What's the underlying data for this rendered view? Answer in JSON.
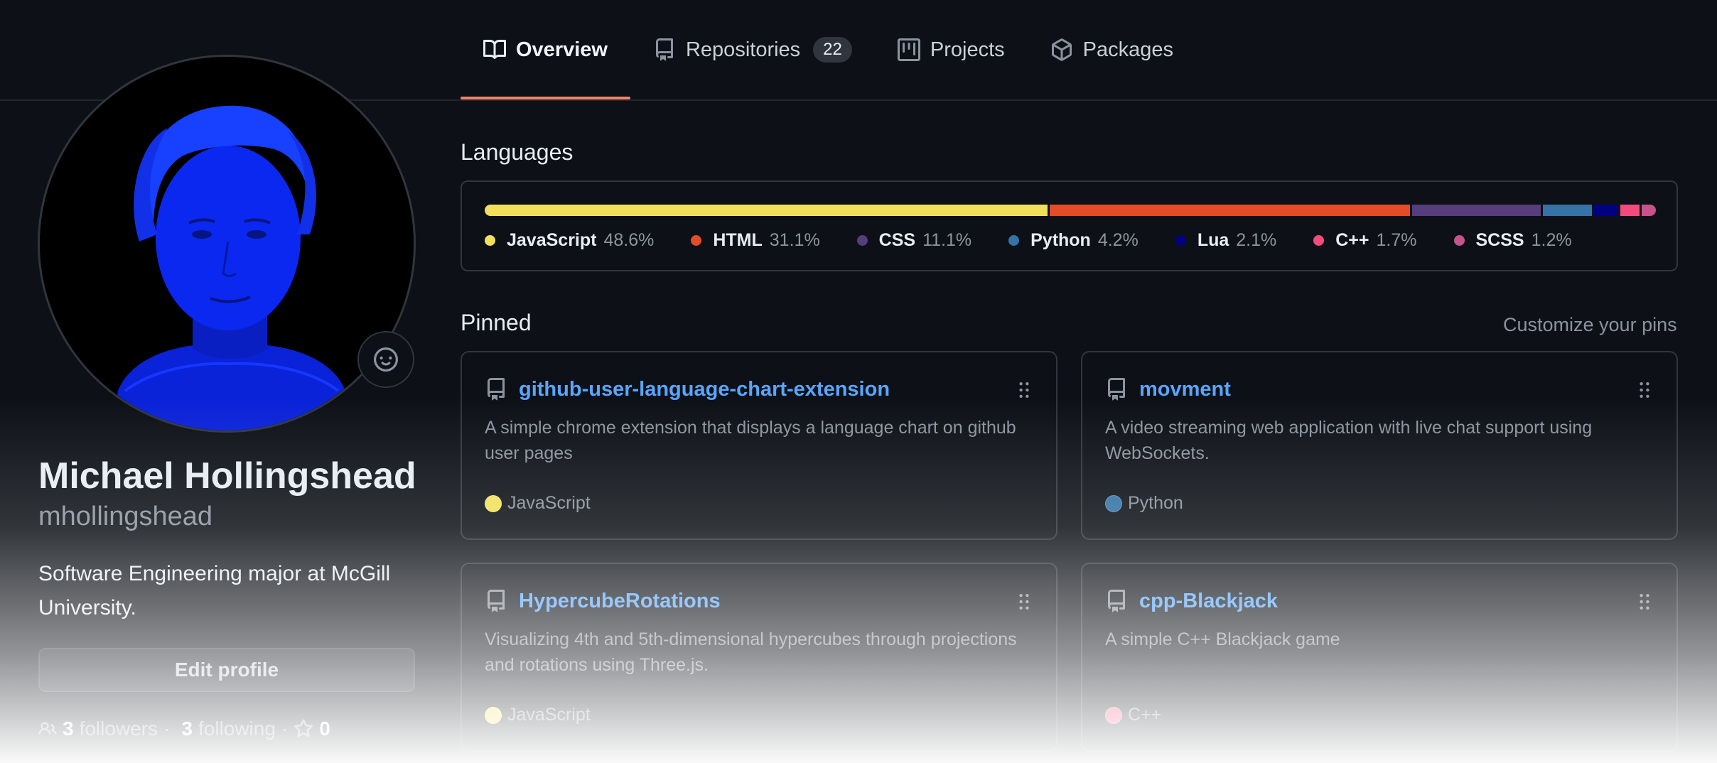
{
  "tabs": [
    {
      "label": "Overview",
      "icon": "book-icon",
      "active": true
    },
    {
      "label": "Repositories",
      "icon": "repo-icon",
      "count": "22"
    },
    {
      "label": "Projects",
      "icon": "project-icon"
    },
    {
      "label": "Packages",
      "icon": "package-icon"
    }
  ],
  "profile": {
    "name": "Michael Hollingshead",
    "login": "mhollingshead",
    "bio": "Software Engineering major at McGill University.",
    "edit_label": "Edit profile",
    "followers_count": "3",
    "followers_label": "followers",
    "following_count": "3",
    "following_label": "following",
    "stars_count": "0",
    "avatar_color": "#0a2cff"
  },
  "languages": {
    "title": "Languages",
    "items": [
      {
        "name": "JavaScript",
        "percent": "48.6%",
        "value": 48.6,
        "color": "#f1e05a"
      },
      {
        "name": "HTML",
        "percent": "31.1%",
        "value": 31.1,
        "color": "#e34c26"
      },
      {
        "name": "CSS",
        "percent": "11.1%",
        "value": 11.1,
        "color": "#563d7c"
      },
      {
        "name": "Python",
        "percent": "4.2%",
        "value": 4.2,
        "color": "#3572a5"
      },
      {
        "name": "Lua",
        "percent": "2.1%",
        "value": 2.1,
        "color": "#000080"
      },
      {
        "name": "C++",
        "percent": "1.7%",
        "value": 1.7,
        "color": "#f34b7d"
      },
      {
        "name": "SCSS",
        "percent": "1.2%",
        "value": 1.2,
        "color": "#c6538c"
      }
    ]
  },
  "pinned": {
    "title": "Pinned",
    "customize_label": "Customize your pins",
    "repos": [
      {
        "name": "github-user-language-chart-extension",
        "description": "A simple chrome extension that displays a language chart on github user pages",
        "language": "JavaScript",
        "color": "#f1e05a"
      },
      {
        "name": "movment",
        "description": "A video streaming web application with live chat support using WebSockets.",
        "language": "Python",
        "color": "#3572a5"
      },
      {
        "name": "HypercubeRotations",
        "description": "Visualizing 4th and 5th-dimensional hypercubes through projections and rotations using Three.js.",
        "language": "JavaScript",
        "color": "#f1e05a"
      },
      {
        "name": "cpp-Blackjack",
        "description": "A simple C++ Blackjack game",
        "language": "C++",
        "color": "#f34b7d"
      }
    ]
  }
}
